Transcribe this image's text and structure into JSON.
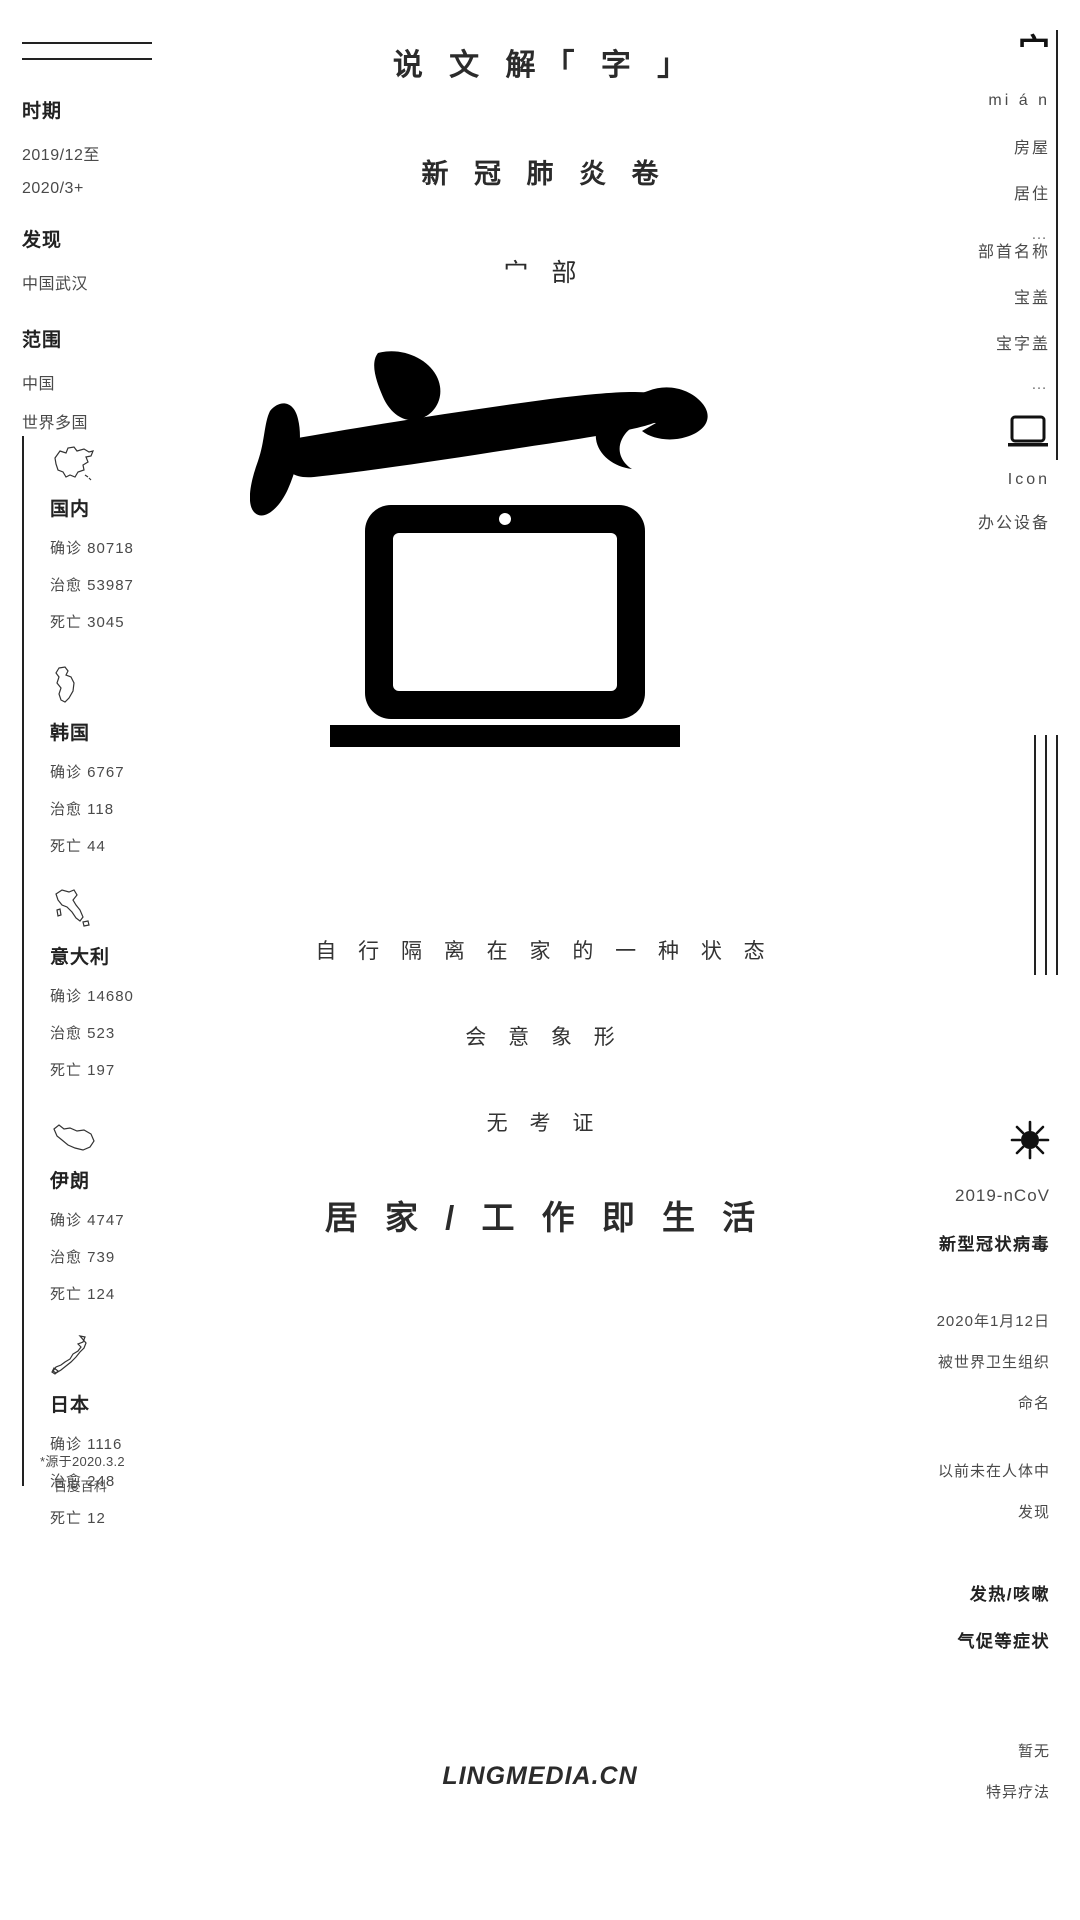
{
  "left": {
    "meta": [
      {
        "title": "时期",
        "lines": [
          "2019/12至",
          "2020/3+"
        ]
      },
      {
        "title": "发现",
        "lines": [
          "中国武汉"
        ]
      },
      {
        "title": "范围",
        "lines": [
          "中国",
          "世界多国"
        ]
      }
    ],
    "stat_labels": {
      "confirmed": "确诊",
      "recovered": "治愈",
      "deaths": "死亡"
    },
    "countries": [
      {
        "map_icon": "china-map-icon",
        "name": "国内",
        "confirmed": "确诊 80718",
        "recovered": "治愈 53987",
        "deaths": "死亡 3045"
      },
      {
        "map_icon": "south-korea-map-icon",
        "name": "韩国",
        "confirmed": "确诊 6767",
        "recovered": "治愈 118",
        "deaths": "死亡 44"
      },
      {
        "map_icon": "italy-map-icon",
        "name": "意大利",
        "confirmed": "确诊 14680",
        "recovered": "治愈 523",
        "deaths": "死亡 197"
      },
      {
        "map_icon": "iran-map-icon",
        "name": "伊朗",
        "confirmed": "确诊 4747",
        "recovered": "治愈 739",
        "deaths": "死亡 124"
      },
      {
        "map_icon": "japan-map-icon",
        "name": "日本",
        "confirmed": "确诊 1116",
        "recovered": "治愈 248",
        "deaths": "死亡 12"
      }
    ],
    "source_line1": "*源于2020.3.2",
    "source_line2": "百度百科"
  },
  "center": {
    "title": "说 文 解「 字 」",
    "subtitle": "新 冠 肺 炎 卷",
    "radical_title": "宀 部",
    "hero_icon": "mian-radical-brushstroke-over-laptop-illustration",
    "desc_1": "自 行 隔 离 在 家 的 一 种 状 态",
    "desc_2": "会 意 象 形",
    "desc_3": "无 考 证",
    "tagline": "居 家 / 工 作 即 生 活",
    "brand": "LINGMEDIA.CN"
  },
  "right": {
    "radical_glyph": "宀",
    "pinyin": "mi á n",
    "meanings": [
      "房屋",
      "居住"
    ],
    "meanings_more": "…",
    "radical_name_label": "部首名称",
    "radical_names": [
      "宝盖",
      "宝字盖"
    ],
    "radical_names_more": "…",
    "icon_name": "laptop-icon",
    "icon_caption": "Icon",
    "icon_category": "办公设备",
    "virus_icon": "coronavirus-icon",
    "virus_code": "2019-nCoV",
    "virus_name": "新型冠状病毒",
    "naming_line1": "2020年1月12日",
    "naming_line2": "被世界卫生组织",
    "naming_line3": "命名",
    "novel_line1": "以前未在人体中",
    "novel_line2": "发现",
    "symptom_line1": "发热/咳嗽",
    "symptom_line2": "气促等症状",
    "treat_line1": "暂无",
    "treat_line2": "特异疗法"
  },
  "colors": {
    "ink": "#2b2b2b",
    "muted": "#4a4a4a",
    "rule": "#222222",
    "bg": "#ffffff"
  }
}
